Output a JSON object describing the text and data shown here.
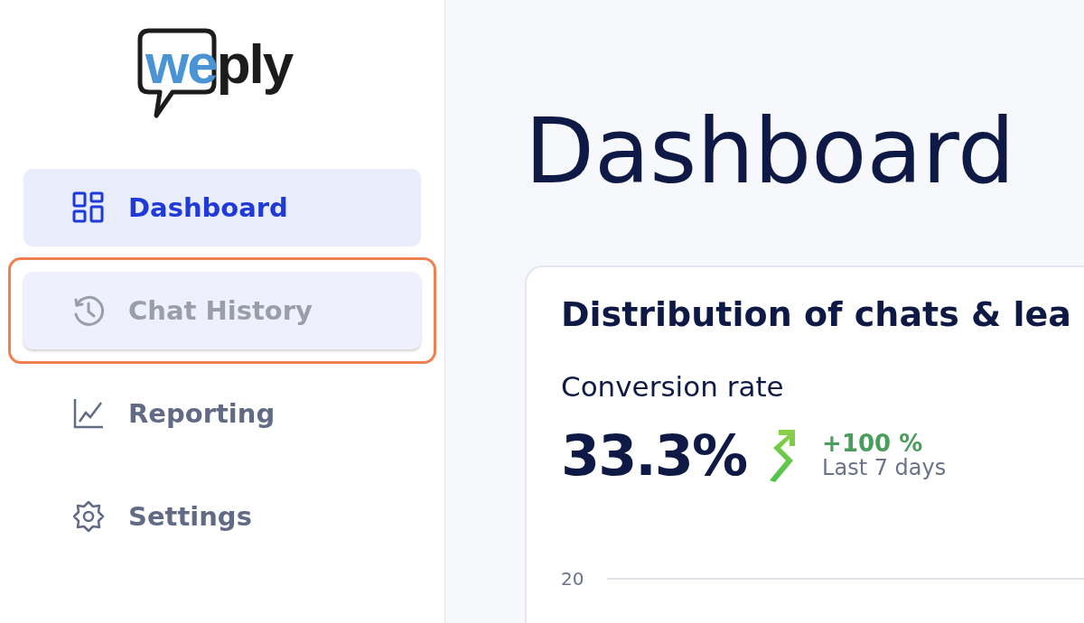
{
  "logo": {
    "parts": [
      {
        "text": "we",
        "color": "#4a93d4"
      },
      {
        "text": "ply",
        "color": "#1c1c1c"
      }
    ]
  },
  "sidebar": {
    "items": [
      {
        "label": "Dashboard",
        "selected": true,
        "highlighted": false
      },
      {
        "label": "Chat History",
        "selected": false,
        "highlighted": true
      },
      {
        "label": "Reporting",
        "selected": false,
        "highlighted": false
      },
      {
        "label": "Settings",
        "selected": false,
        "highlighted": false
      }
    ]
  },
  "page_title": "Dashboard",
  "card": {
    "title": "Distribution of chats & lea",
    "metric_label": "Conversion rate",
    "metric_value": "33.3%",
    "change": "+100 %",
    "period": "Last 7 days",
    "axis_tick": "20"
  }
}
